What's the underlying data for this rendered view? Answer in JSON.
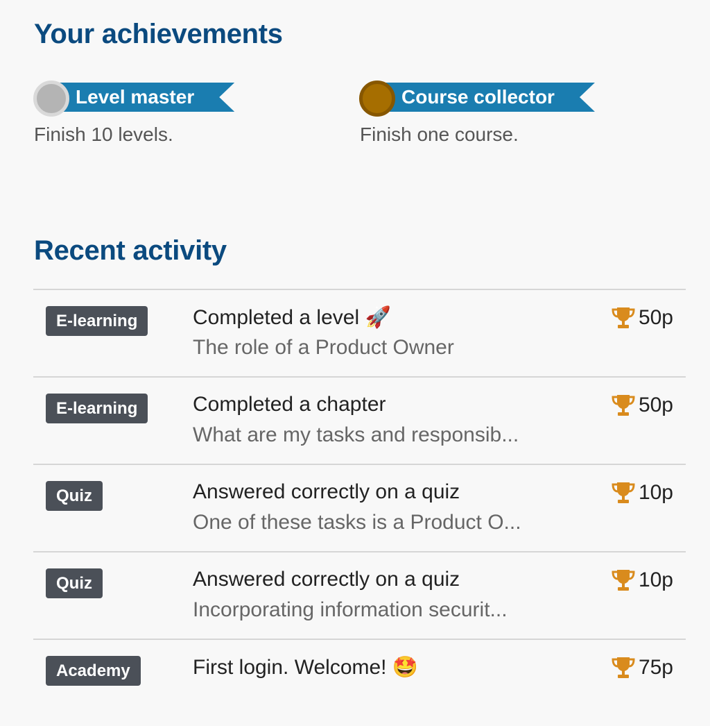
{
  "achievements_section": {
    "title": "Your achievements",
    "items": [
      {
        "name": "Level master",
        "description": "Finish 10 levels.",
        "medal": "silver",
        "medal_color": "#b4b4b4"
      },
      {
        "name": "Course collector",
        "description": "Finish one course.",
        "medal": "gold",
        "medal_color": "#a66e00"
      }
    ]
  },
  "activity_section": {
    "title": "Recent activity",
    "rows": [
      {
        "tag": "E-learning",
        "title": "Completed a level",
        "emoji": "🚀",
        "subtitle": "The role of a Product Owner",
        "points": "50p",
        "icon": "trophy-icon"
      },
      {
        "tag": "E-learning",
        "title": "Completed a chapter",
        "emoji": "",
        "subtitle": "What are my tasks and responsib...",
        "points": "50p",
        "icon": "trophy-icon"
      },
      {
        "tag": "Quiz",
        "title": "Answered correctly on a quiz",
        "emoji": "",
        "subtitle": "One of these tasks is a Product O...",
        "points": "10p",
        "icon": "trophy-icon"
      },
      {
        "tag": "Quiz",
        "title": "Answered correctly on a quiz",
        "emoji": "",
        "subtitle": "Incorporating information securit...",
        "points": "10p",
        "icon": "trophy-icon"
      },
      {
        "tag": "Academy",
        "title": "First login. Welcome!",
        "emoji": "🤩",
        "subtitle": "",
        "points": "75p",
        "icon": "trophy-icon"
      }
    ]
  },
  "colors": {
    "heading": "#0b4a7f",
    "ribbon": "#1a7db0",
    "tag": "#4b5058",
    "trophy": "#d98b1d"
  }
}
